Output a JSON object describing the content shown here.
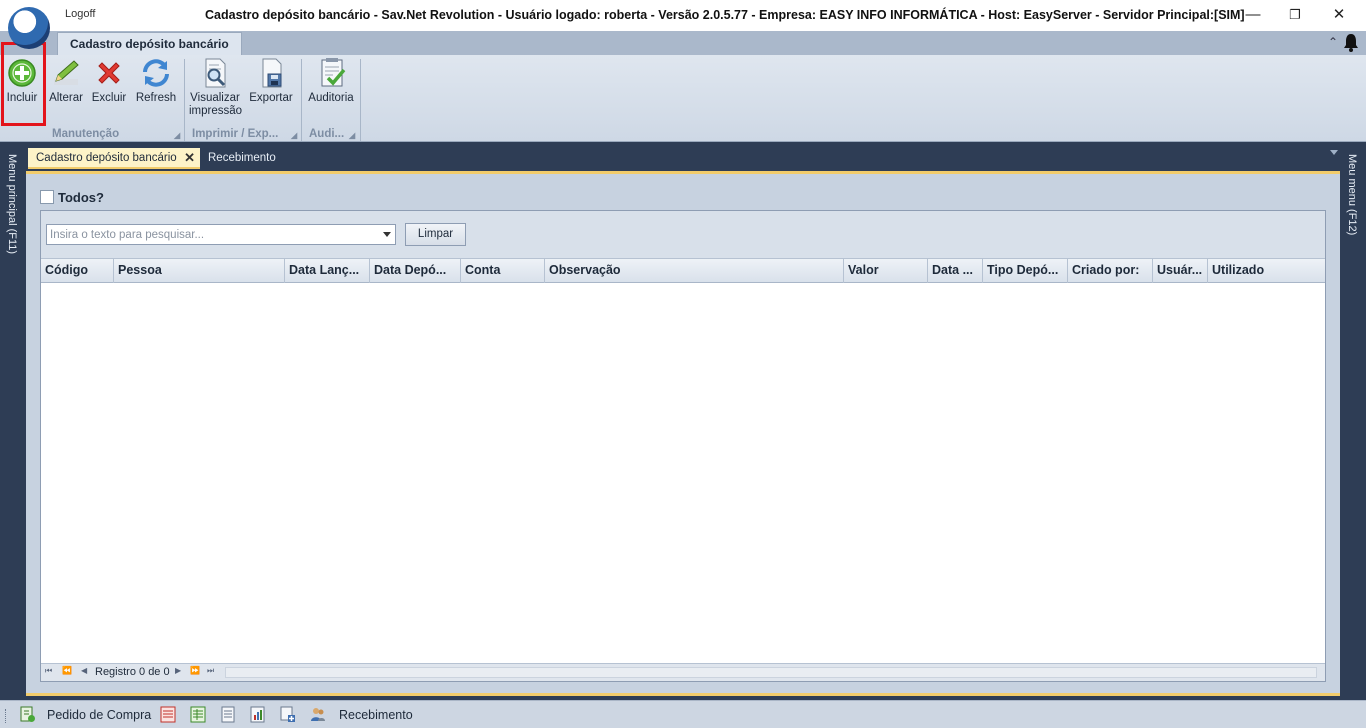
{
  "window": {
    "logoff_label": "Logoff",
    "title": "Cadastro depósito bancário - Sav.Net Revolution - Usuário logado: roberta - Versão 2.0.5.77 - Empresa: EASY INFO INFORMÁTICA - Host: EasyServer - Servidor Principal:[SIM]",
    "minimize": "—",
    "restore": "❐",
    "close": "✕"
  },
  "ribbon": {
    "tab_label": "Cadastro depósito bancário",
    "collapse_glyph": "⌃",
    "groups": [
      {
        "label": "Manutenção",
        "buttons": [
          {
            "label": "Incluir",
            "icon": "add-circle-icon"
          },
          {
            "label": "Alterar",
            "icon": "pencil-icon"
          },
          {
            "label": "Excluir",
            "icon": "delete-x-icon"
          },
          {
            "label": "Refresh",
            "icon": "refresh-icon"
          }
        ]
      },
      {
        "label": "Imprimir / Exp...",
        "buttons": [
          {
            "label_line1": "Visualizar",
            "label_line2": "impressão",
            "icon": "print-preview-icon"
          },
          {
            "label": "Exportar",
            "icon": "export-icon"
          }
        ]
      },
      {
        "label": "Audi...",
        "buttons": [
          {
            "label": "Auditoria",
            "icon": "audit-icon"
          }
        ]
      }
    ]
  },
  "side_panels": {
    "left": "Menu principal (F11)",
    "right": "Meu menu (F12)"
  },
  "document_tabs": [
    {
      "label": "Cadastro depósito bancário",
      "active": true,
      "close_glyph": "✕"
    },
    {
      "label": "Recebimento",
      "active": false
    }
  ],
  "filter": {
    "todos_label": "Todos?",
    "search_placeholder": "Insira o texto para pesquisar...",
    "clear_button": "Limpar"
  },
  "grid": {
    "columns": [
      "Código",
      "Pessoa",
      "Data Lanç...",
      "Data Depó...",
      "Conta",
      "Observação",
      "Valor",
      "Data ...",
      "Tipo Depó...",
      "Criado por:",
      "Usuár...",
      "Utilizado"
    ],
    "rows": [],
    "record_text": "Registro 0 de 0",
    "nav": {
      "first": "⏮",
      "prev_page": "⏪",
      "prev": "◀",
      "next": "▶",
      "next_page": "⏩",
      "last": "⏭"
    }
  },
  "statusbar": {
    "items": [
      {
        "label": "Pedido de Compra",
        "icon": "purchase-order-icon"
      },
      {
        "icon": "report-red-icon"
      },
      {
        "icon": "spreadsheet-green-icon"
      },
      {
        "icon": "document-list-icon"
      },
      {
        "icon": "chart-document-icon"
      },
      {
        "icon": "document-add-icon"
      },
      {
        "label": "Recebimento",
        "icon": "users-receipt-icon"
      }
    ]
  },
  "colors": {
    "accent_highlight": "#e3141b",
    "tab_active": "#fdf3c8",
    "dark_frame": "#2e3d55"
  }
}
